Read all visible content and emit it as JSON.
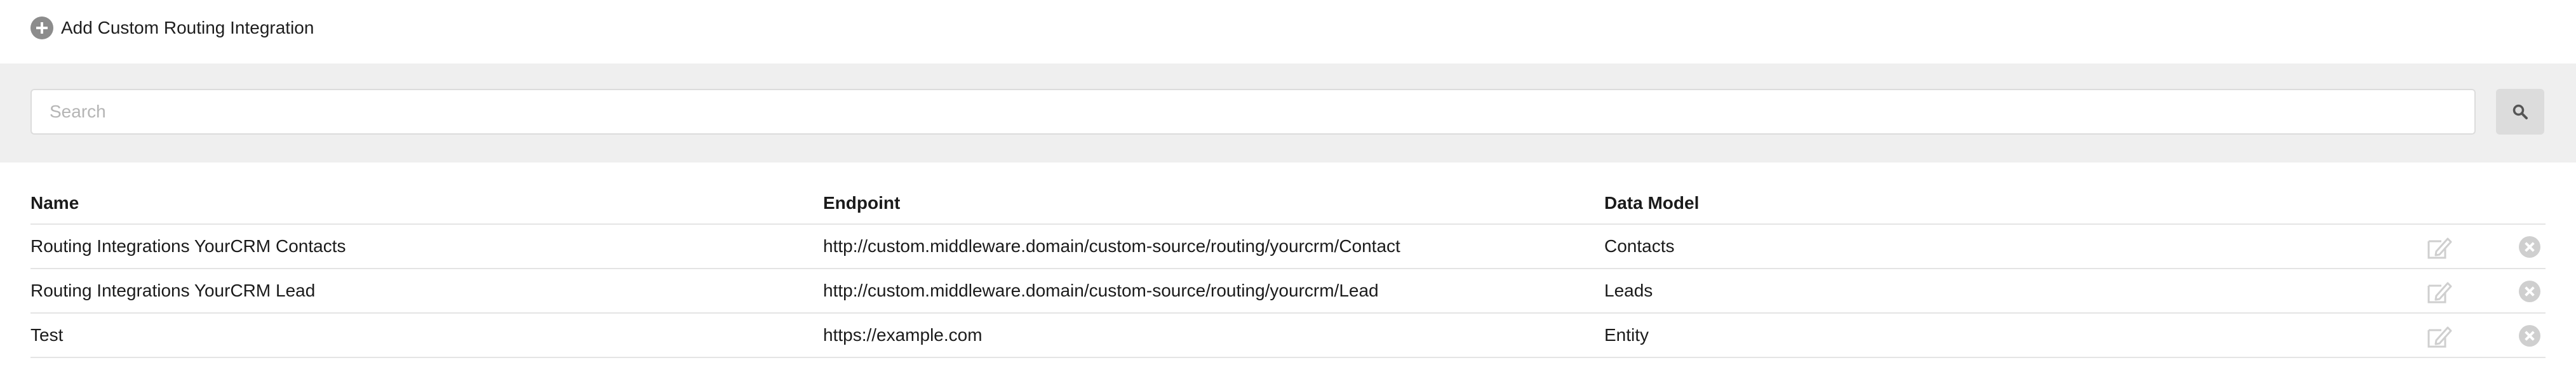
{
  "toolbar": {
    "add_label": "Add Custom Routing Integration",
    "add_icon": "plus-circle-icon"
  },
  "search": {
    "placeholder": "Search",
    "value": "",
    "button_icon": "search-icon"
  },
  "table": {
    "columns": [
      "Name",
      "Endpoint",
      "Data Model"
    ],
    "rows": [
      {
        "name": "Routing Integrations YourCRM Contacts",
        "endpoint": "http://custom.middleware.domain/custom-source/routing/yourcrm/Contact",
        "data_model": "Contacts"
      },
      {
        "name": "Routing Integrations YourCRM Lead",
        "endpoint": "http://custom.middleware.domain/custom-source/routing/yourcrm/Lead",
        "data_model": "Leads"
      },
      {
        "name": "Test",
        "endpoint": "https://example.com",
        "data_model": "Entity"
      }
    ],
    "row_actions": [
      "edit-icon",
      "delete-icon"
    ]
  },
  "colors": {
    "search_band": "#efefef",
    "icon_grey": "#8c8c8c",
    "border": "#e4e4e4"
  }
}
